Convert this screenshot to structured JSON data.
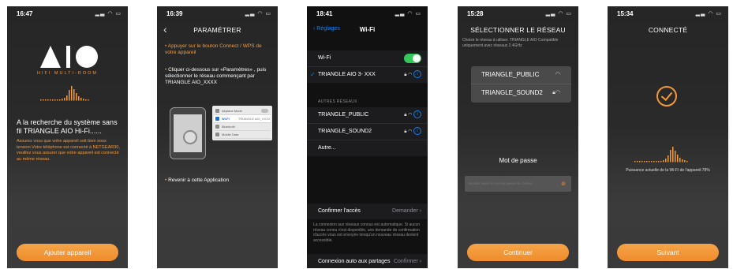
{
  "screens": [
    {
      "time": "16:47",
      "logo_text": "AIO",
      "tagline": "HIFI MULTI-ROOM",
      "heading": "A la recherche du système sans fil TRIANGLE AIO Hi-Fi......",
      "body": "Assurez vous que votre appareil soit bien sous tension.Votre téléphone est connecté à NETGEAR30, veuillez vous assurer que votre appareil est connecté au même réseau.",
      "button": "Ajouter appareil"
    },
    {
      "time": "16:39",
      "title": "PARAMÉTRER",
      "step1": "Appuyer sur le bouton Connect / WPS de votre appareil",
      "step2": "Cliquer ci-dessous sur «Paramètres» , puis sélectionner le réseau commençant par TRIANGLE AIO_XXXX",
      "illus_rows": [
        "Airplane Mode",
        "Wi-Fi",
        "Bluetooth",
        "Mobile Data"
      ],
      "illus_wifi_value": "TRIANGLE AIO_XXXX",
      "step3": "Revenir à cette Application"
    },
    {
      "time": "18:41",
      "back": "Réglages",
      "title": "Wi-Fi",
      "wifi_label": "Wi-Fi",
      "connected": "TRIANGLE AIO 3- XXX",
      "section": "AUTRES RÉSEAUX",
      "networks": [
        "TRIANGLE_PUBLIC",
        "TRIANGLE_SOUND2",
        "Autre..."
      ],
      "ask_label": "Confirmer l'accès",
      "ask_value": "Demander",
      "ask_note": "La connexion aux réseaux connus est automatique. Si aucun réseau connu n'est disponible, une demande de confirmation d'accès vous est envoyée lorsqu'un nouveau réseau devient accessible.",
      "auto_label": "Connexion auto aux partages",
      "auto_value": "Confirmer"
    },
    {
      "time": "15:28",
      "title": "SÉLECTIONNER LE RÉSEAU",
      "subtitle": "Choisir le réseau à utiliser. TRIANGLE AIO Compatible uniquement avec réseaux 2.4GHz",
      "networks": [
        "TRIANGLE_PUBLIC",
        "TRIANGLE_SOUND2"
      ],
      "password_label": "Mot de passe",
      "password_placeholder": "Veuillez saisir le mot de passe du routeur",
      "button": "Continuer"
    },
    {
      "time": "15:34",
      "title": "CONNECTÉ",
      "strength": "Puissance actuelle de la Wi-Fi de l'appareil:78%",
      "button": "Suivant"
    }
  ],
  "colors": {
    "accent": "#f29a3a",
    "ios_blue": "#0a84ff",
    "ios_green": "#34c759"
  },
  "icons": {
    "wifi": "wifi-icon",
    "lock": "lock-icon",
    "info": "info-icon",
    "back": "chevron-left-icon",
    "eye": "eye-off-icon",
    "check": "checkmark-icon"
  }
}
